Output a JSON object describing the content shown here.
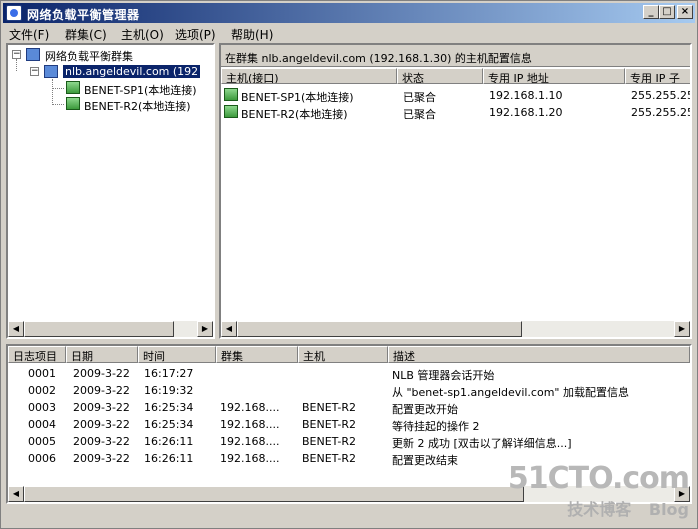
{
  "window": {
    "title": "网络负载平衡管理器",
    "buttons": {
      "minimize": "_",
      "maximize": "□",
      "close": "×"
    }
  },
  "menu": [
    {
      "label": "文件(F)"
    },
    {
      "label": "群集(C)"
    },
    {
      "label": "主机(O)"
    },
    {
      "label": "选项(P)"
    },
    {
      "label": "帮助(H)"
    }
  ],
  "tree": {
    "root": "网络负载平衡群集",
    "cluster": "nlb.angeldevil.com (192",
    "hosts": [
      "BENET-SP1(本地连接)",
      "BENET-R2(本地连接)"
    ]
  },
  "hosts_panel": {
    "header": "在群集 nlb.angeldevil.com (192.168.1.30) 的主机配置信息",
    "columns": [
      "主机(接口)",
      "状态",
      "专用 IP 地址",
      "专用 IP 子"
    ],
    "rows": [
      {
        "host": "BENET-SP1(本地连接)",
        "status": "已聚合",
        "ip": "192.168.1.10",
        "mask": "255.255.25"
      },
      {
        "host": "BENET-R2(本地连接)",
        "status": "已聚合",
        "ip": "192.168.1.20",
        "mask": "255.255.25"
      }
    ]
  },
  "log": {
    "columns": [
      "日志项目",
      "日期",
      "时间",
      "群集",
      "主机",
      "描述"
    ],
    "rows": [
      {
        "id": "0001",
        "date": "2009-3-22",
        "time": "16:17:27",
        "cluster": "",
        "host": "",
        "desc": "NLB 管理器会话开始"
      },
      {
        "id": "0002",
        "date": "2009-3-22",
        "time": "16:19:32",
        "cluster": "",
        "host": "",
        "desc": "从 \"benet-sp1.angeldevil.com\" 加载配置信息"
      },
      {
        "id": "0003",
        "date": "2009-3-22",
        "time": "16:25:34",
        "cluster": "192.168....",
        "host": "BENET-R2",
        "desc": "配置更改开始"
      },
      {
        "id": "0004",
        "date": "2009-3-22",
        "time": "16:25:34",
        "cluster": "192.168....",
        "host": "BENET-R2",
        "desc": "等待挂起的操作 2"
      },
      {
        "id": "0005",
        "date": "2009-3-22",
        "time": "16:26:11",
        "cluster": "192.168....",
        "host": "BENET-R2",
        "desc": "更新 2 成功 [双击以了解详细信息...]"
      },
      {
        "id": "0006",
        "date": "2009-3-22",
        "time": "16:26:11",
        "cluster": "192.168....",
        "host": "BENET-R2",
        "desc": "配置更改结束"
      }
    ]
  },
  "watermark": {
    "main": "51CTO.com",
    "sub": "技术博客",
    "blog": "Blog"
  }
}
